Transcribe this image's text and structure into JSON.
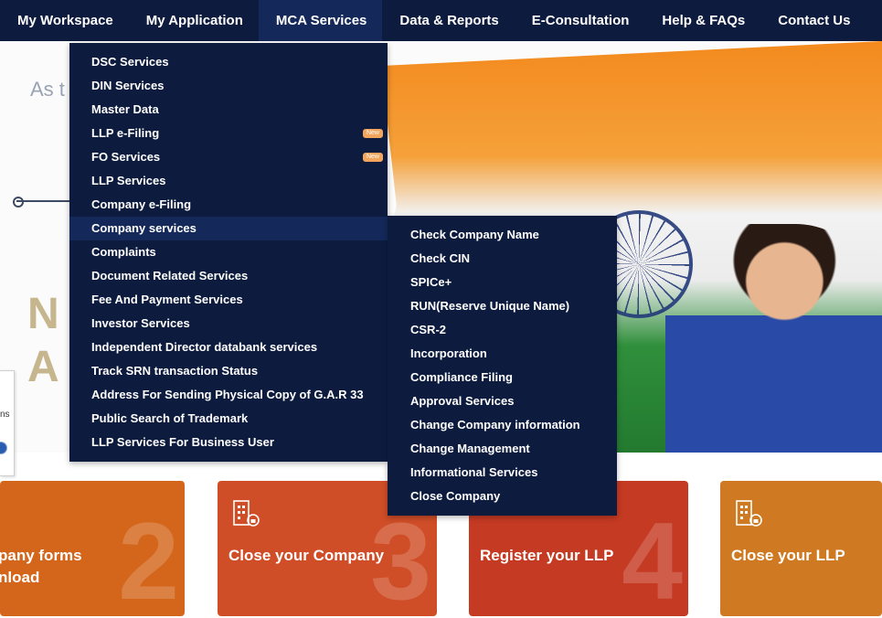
{
  "topnav": {
    "items": [
      {
        "label": "My Workspace"
      },
      {
        "label": "My Application"
      },
      {
        "label": "MCA Services"
      },
      {
        "label": "Data & Reports"
      },
      {
        "label": "E-Consultation"
      },
      {
        "label": "Help & FAQs"
      },
      {
        "label": "Contact Us"
      }
    ],
    "active": "MCA Services",
    "bg_color": "#0d1b3e"
  },
  "banner": {
    "partial_text": "As t",
    "partial_letters_1": "N",
    "partial_letters_2": "A"
  },
  "left_widget": {
    "partial_text": "ns"
  },
  "mca_menu": {
    "items": [
      {
        "label": "DSC Services"
      },
      {
        "label": "DIN Services"
      },
      {
        "label": "Master Data"
      },
      {
        "label": "LLP e-Filing",
        "badge": "New"
      },
      {
        "label": "FO Services",
        "badge": "New"
      },
      {
        "label": "LLP Services"
      },
      {
        "label": "Company e-Filing"
      },
      {
        "label": "Company services"
      },
      {
        "label": "Complaints"
      },
      {
        "label": "Document Related Services"
      },
      {
        "label": "Fee And Payment Services"
      },
      {
        "label": "Investor Services"
      },
      {
        "label": "Independent Director databank services"
      },
      {
        "label": "Track SRN transaction Status"
      },
      {
        "label": "Address For Sending Physical Copy of G.A.R 33"
      },
      {
        "label": "Public Search of Trademark"
      },
      {
        "label": "LLP Services For Business User"
      }
    ],
    "active": "Company services",
    "badge_color": "#f3a55b"
  },
  "company_services_menu": {
    "items": [
      {
        "label": "Check Company Name"
      },
      {
        "label": "Check CIN"
      },
      {
        "label": "SPICe+"
      },
      {
        "label": "RUN(Reserve Unique Name)"
      },
      {
        "label": "CSR-2"
      },
      {
        "label": "Incorporation"
      },
      {
        "label": "Compliance Filing"
      },
      {
        "label": "Approval Services"
      },
      {
        "label": "Change Company information"
      },
      {
        "label": "Change Management"
      },
      {
        "label": "Informational Services"
      },
      {
        "label": "Close Company"
      }
    ]
  },
  "cards": [
    {
      "title_line1": "pany forms",
      "title_line2": "nload",
      "number": "2",
      "color": "#d4661b"
    },
    {
      "title": "Close your Company",
      "number": "3",
      "icon": "building-icon",
      "color": "#cf4d27"
    },
    {
      "title": "Register your LLP",
      "number": "4",
      "icon": "check-box-icon",
      "color": "#c53a23"
    },
    {
      "title": "Close your LLP",
      "icon": "building-icon",
      "color": "#cf7a22"
    }
  ]
}
